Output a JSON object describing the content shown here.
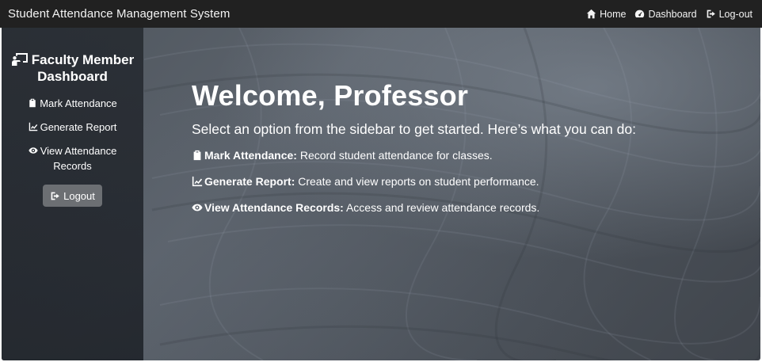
{
  "header": {
    "brand": "Student Attendance Management System",
    "nav": [
      {
        "label": "Home",
        "icon": "home-icon"
      },
      {
        "label": "Dashboard",
        "icon": "dashboard-icon"
      },
      {
        "label": "Log-out",
        "icon": "logout-icon"
      }
    ]
  },
  "sidebar": {
    "title": "Faculty Member Dashboard",
    "title_icon": "chalkboard-teacher-icon",
    "items": [
      {
        "label": "Mark Attendance",
        "icon": "clipboard-check-icon"
      },
      {
        "label": "Generate Report",
        "icon": "chart-line-icon"
      },
      {
        "label": "View Attendance Records",
        "icon": "eye-icon"
      }
    ],
    "logout_label": "Logout"
  },
  "main": {
    "heading": "Welcome, Professor",
    "subtitle": "Select an option from the sidebar to get started. Here’s what you can do:",
    "features": [
      {
        "title": "Mark Attendance:",
        "description": "Record student attendance for classes.",
        "icon": "clipboard-check-icon"
      },
      {
        "title": "Generate Report:",
        "description": "Create and view reports on student performance.",
        "icon": "chart-line-icon"
      },
      {
        "title": "View Attendance Records:",
        "description": "Access and review attendance records.",
        "icon": "eye-icon"
      }
    ]
  },
  "colors": {
    "topbar": "#212121",
    "sidebar": "#20242a",
    "logout_button": "#6c6f73",
    "text": "#ffffff"
  }
}
